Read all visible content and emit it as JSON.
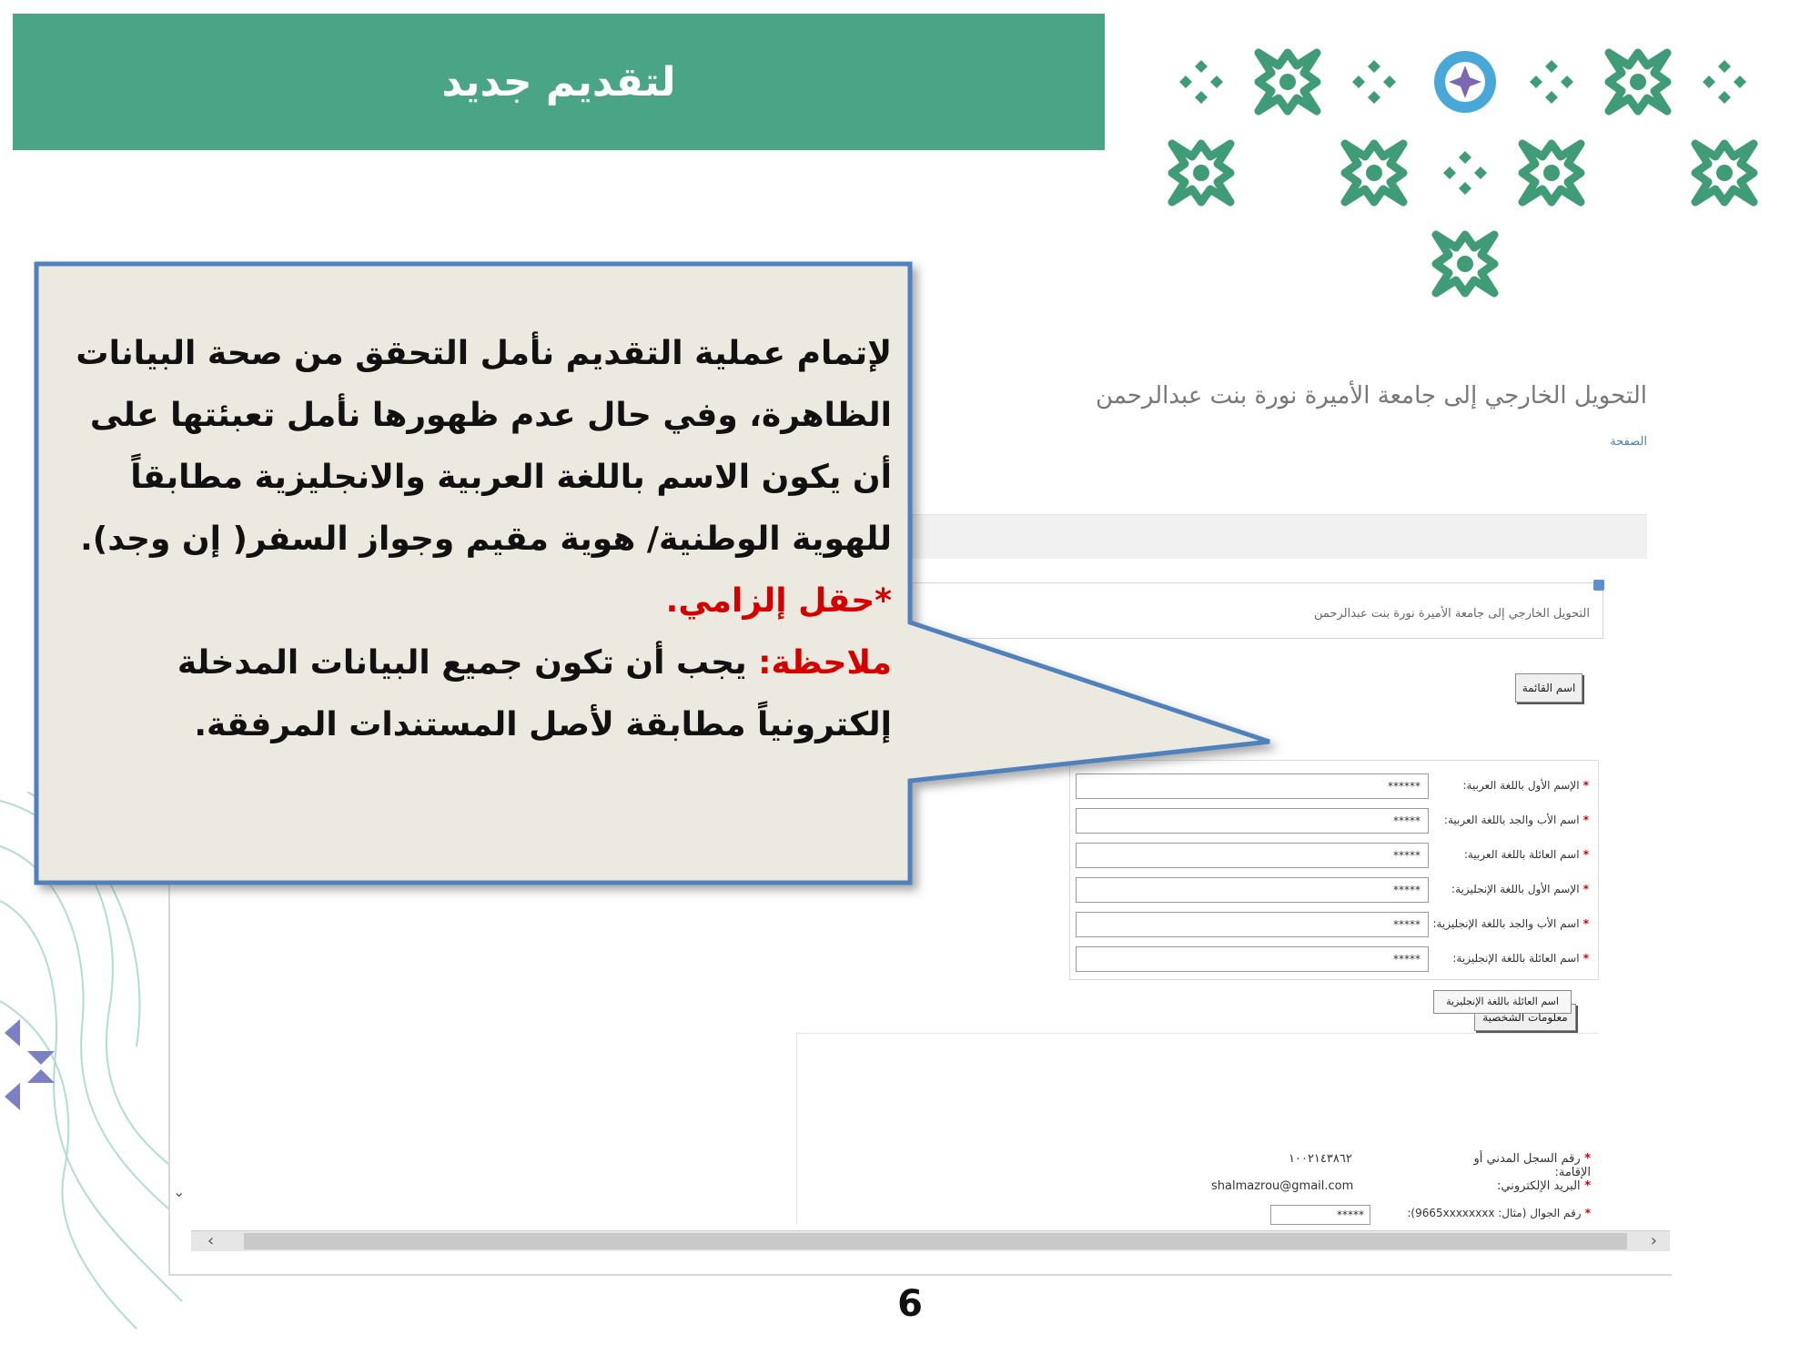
{
  "banner": {
    "title": "لتقديم جديد"
  },
  "screenshot": {
    "title": "التحويل الخارجي إلى جامعة الأميرة نورة بنت عبدالرحمن",
    "breadcrumb": "الصفحة",
    "info_text": "التحويل الخارجي إلى جامعة الأميرة نورة بنت عبدالرحمن",
    "list_button": "اسم القائمة",
    "fields": [
      {
        "label": "الإسم الأول باللغة العربية:",
        "value": "******"
      },
      {
        "label": "اسم الأب والجد باللغة العربية:",
        "value": "*****"
      },
      {
        "label": "اسم العائلة باللغة العربية:",
        "value": "*****"
      },
      {
        "label": "الإسم الأول باللغة الإنجليزية:",
        "value": "*****"
      },
      {
        "label": "اسم الأب والجد باللغة الإنجليزية:",
        "value": "*****"
      },
      {
        "label": "اسم العائلة باللغة الإنجليزية:",
        "value": "*****"
      }
    ],
    "tooltip_button": "اسم العائلة باللغة الإنجليزية",
    "section_button": "معلومات الشخصية",
    "lower_fields": [
      {
        "label": "رقم السجل المدني أو الإقامة:",
        "value": "١٠٠٢١٤٣٨٦٢"
      },
      {
        "label": "البريد الإلكتروني:",
        "value": "shalmazrou@gmail.com"
      },
      {
        "label": "رقم الجوال (مثال: 9665xxxxxxxx):",
        "value": "*****"
      }
    ]
  },
  "callout": {
    "paragraph1": "لإتمام عملية التقديم نأمل التحقق من صحة البيانات الظاهرة، وفي حال عدم ظهورها نأمل تعبئتها على أن يكون الاسم باللغة العربية والانجليزية مطابقاً للهوية الوطنية/ هوية مقيم وجواز السفر( إن وجد).",
    "required": "*حقل إلزامي.",
    "note_label": "ملاحظة:",
    "note_text": " يجب أن تكون جميع البيانات المدخلة إلكترونياً مطابقة لأصل المستندات المرفقة."
  },
  "page_number": "6",
  "colors": {
    "banner": "#49a585",
    "callout_fill": "#ece9e0",
    "callout_border": "#4f81bd",
    "required_red": "#d40000"
  }
}
